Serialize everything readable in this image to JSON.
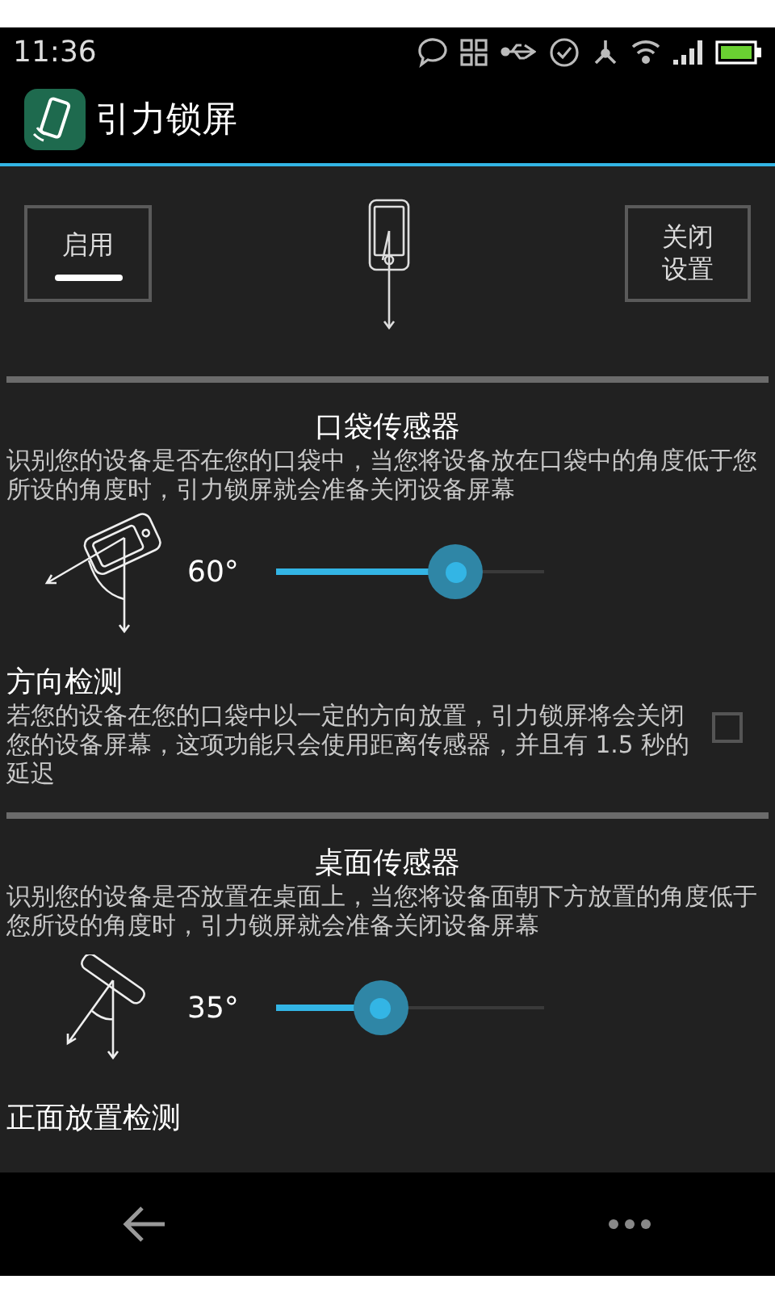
{
  "status_bar": {
    "time": "11:36"
  },
  "app_bar": {
    "title": "引力锁屏"
  },
  "controls": {
    "enable": {
      "label": "启用",
      "on": true
    },
    "close_settings": {
      "label": "关闭设置"
    }
  },
  "sections": [
    {
      "title": "口袋传感器",
      "description": "识别您的设备是否在您的口袋中，当您将设备放在口袋中的角度低于您所设的角度时，引力锁屏就会准备关闭设备屏幕",
      "kind": "pocket",
      "angle": "60°",
      "level": 0.67,
      "option": {
        "title": "方向检测",
        "description": "若您的设备在您的口袋中以一定的方向放置，引力锁屏将会关闭您的设备屏幕，这项功能只会使用距离传感器，并且有 1.5 秒的延迟",
        "checked": false
      }
    },
    {
      "title": "桌面传感器",
      "description": "识别您的设备是否放置在桌面上，当您将设备面朝下方放置的角度低于您所设的角度时，引力锁屏就会准备关闭设备屏幕",
      "kind": "table",
      "angle": "35°",
      "level": 0.39,
      "option": {
        "title": "正面放置检测"
      }
    }
  ]
}
